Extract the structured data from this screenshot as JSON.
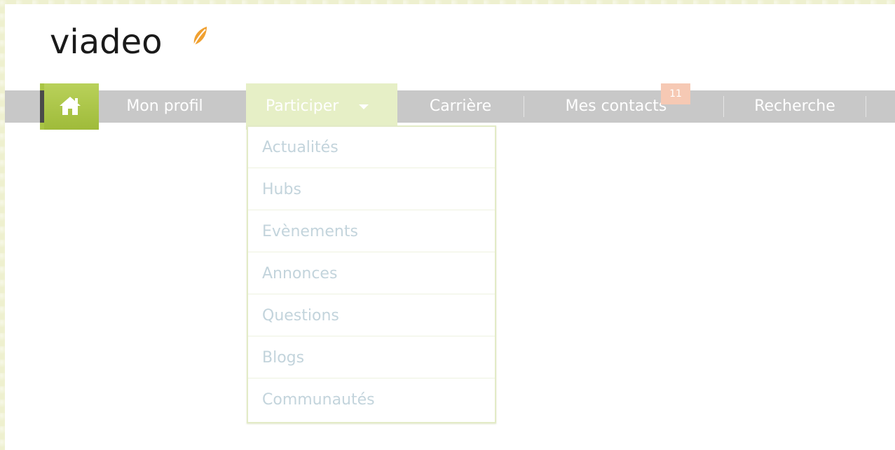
{
  "logo": {
    "text": "viadeo"
  },
  "nav": {
    "home_icon": "home-icon",
    "items": [
      {
        "label": "Mon profil"
      },
      {
        "label": "Participer"
      },
      {
        "label": "Carrière"
      },
      {
        "label": "Mes contacts"
      },
      {
        "label": "Recherche"
      }
    ],
    "contacts_badge": "11"
  },
  "dropdown": {
    "items": [
      {
        "label": "Actualités"
      },
      {
        "label": "Hubs"
      },
      {
        "label": "Evènements"
      },
      {
        "label": "Annonces"
      },
      {
        "label": "Questions"
      },
      {
        "label": "Blogs"
      },
      {
        "label": "Communautés"
      }
    ]
  },
  "colors": {
    "accent_green": "#a9c545",
    "navbar_gray": "#c8c8c8",
    "active_tab": "#e6efc6",
    "badge": "#f6c9b4",
    "dropdown_text": "#c3d4dc"
  }
}
